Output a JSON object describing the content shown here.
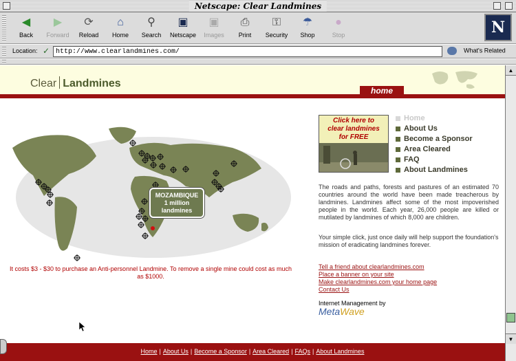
{
  "window": {
    "title": "Netscape: Clear Landmines"
  },
  "toolbar": {
    "buttons": [
      {
        "label": "Back",
        "icon": "back-arrow-icon",
        "enabled": true
      },
      {
        "label": "Forward",
        "icon": "forward-arrow-icon",
        "enabled": false
      },
      {
        "label": "Reload",
        "icon": "reload-icon",
        "enabled": true
      },
      {
        "label": "Home",
        "icon": "home-icon",
        "enabled": true
      },
      {
        "label": "Search",
        "icon": "search-icon",
        "enabled": true
      },
      {
        "label": "Netscape",
        "icon": "netscape-icon",
        "enabled": true
      },
      {
        "label": "Images",
        "icon": "images-icon",
        "enabled": false
      },
      {
        "label": "Print",
        "icon": "print-icon",
        "enabled": true
      },
      {
        "label": "Security",
        "icon": "security-lock-icon",
        "enabled": true
      },
      {
        "label": "Shop",
        "icon": "shop-bag-icon",
        "enabled": true
      },
      {
        "label": "Stop",
        "icon": "stop-icon",
        "enabled": false
      }
    ],
    "logo": "N"
  },
  "location": {
    "label": "Location:",
    "url": "http://www.clearlandmines.com/",
    "related": "What's Related"
  },
  "site": {
    "brand_left": "Clear",
    "brand_right": "Landmines",
    "home_tab": "home",
    "mozambique": {
      "line1": "MOZAMBIQUE",
      "line2": "1 million",
      "line3": "landmines"
    },
    "caption": "It costs $3 - $30 to purchase an Anti-personnel Landmine. To remove a single mine could cost as much as $1000.",
    "promo": {
      "line1": "Click here to",
      "line2": "clear landmines",
      "line3": "for FREE"
    },
    "menu": [
      {
        "label": "Home",
        "active": true
      },
      {
        "label": "About Us",
        "active": false
      },
      {
        "label": "Become a Sponsor",
        "active": false
      },
      {
        "label": "Area Cleared",
        "active": false
      },
      {
        "label": "FAQ",
        "active": false
      },
      {
        "label": "About Landmines",
        "active": false
      }
    ],
    "intro": "The roads and paths, forests and pastures of an estimated 70 countries around the world have been made treacherous by landmines. Landmines affect some of the most impoverished people in the world. Each year, 26,000 people are killed or mutilated by landmines of which 8,000 are children.",
    "intro2": "Your simple click, just once daily will help support the foundation's mission of eradicating landmines forever.",
    "links": [
      "Tell a friend about clearlandmines.com",
      "Place a banner on your site",
      "Make clearlandmines.com your home page",
      "Contact Us"
    ],
    "mgmt_label": "Internet Management by",
    "mgmt_brand_a": "Meta",
    "mgmt_brand_b": "Wave",
    "footer": [
      "Home",
      "About Us",
      "Become a Sponsor",
      "Area Cleared",
      "FAQs",
      "About Landmines"
    ]
  },
  "colors": {
    "accent_red": "#9a1111",
    "header_bg": "#fdfde0",
    "olive": "#5f6a3b"
  }
}
